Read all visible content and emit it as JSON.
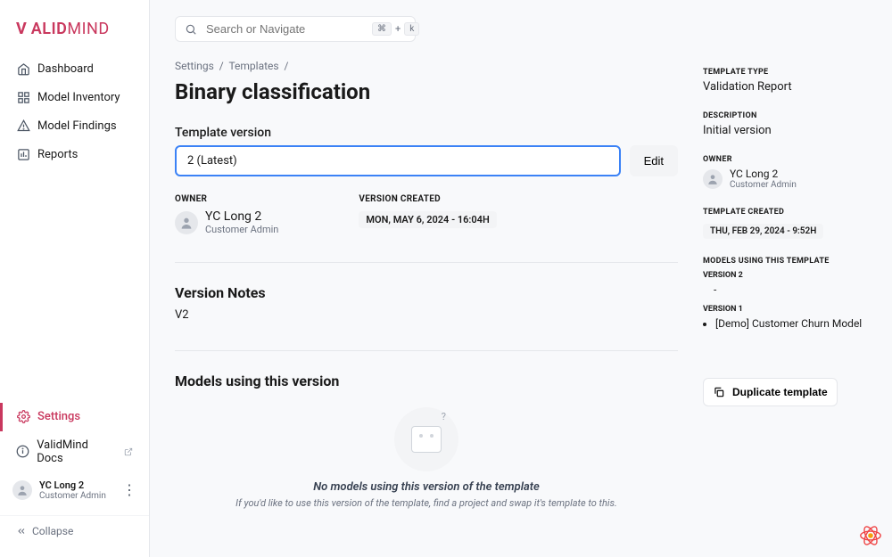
{
  "brand": "VALIDMIND",
  "sidebar": {
    "items": [
      {
        "label": "Dashboard",
        "icon": "home-icon"
      },
      {
        "label": "Model Inventory",
        "icon": "inventory-icon"
      },
      {
        "label": "Model Findings",
        "icon": "findings-icon"
      },
      {
        "label": "Reports",
        "icon": "reports-icon"
      }
    ],
    "settings_label": "Settings",
    "docs_label": "ValidMind Docs",
    "collapse_label": "Collapse"
  },
  "search": {
    "placeholder": "Search or Navigate",
    "kbd1": "⌘",
    "plus": "+",
    "kbd2": "k"
  },
  "breadcrumb": {
    "settings": "Settings",
    "templates": "Templates"
  },
  "page_title": "Binary classification",
  "version_label": "Template version",
  "version_value": "2 (Latest)",
  "edit_label": "Edit",
  "owner_label": "OWNER",
  "owner": {
    "name": "YC Long 2",
    "role": "Customer Admin"
  },
  "version_created_label": "VERSION CREATED",
  "version_created": "MON, MAY 6, 2024 - 16:04H",
  "notes_heading": "Version Notes",
  "notes_body": "V2",
  "models_heading": "Models using this version",
  "empty": {
    "title": "No models using this version of the template",
    "sub": "If you'd like to use this version of the template, find a project and swap it's template to this."
  },
  "right": {
    "template_type_label": "TEMPLATE TYPE",
    "template_type": "Validation Report",
    "description_label": "DESCRIPTION",
    "description": "Initial version",
    "owner_label": "OWNER",
    "owner": {
      "name": "YC Long 2",
      "role": "Customer Admin"
    },
    "template_created_label": "TEMPLATE CREATED",
    "template_created": "THU, FEB 29, 2024 - 9:52H",
    "models_using_label": "MODELS USING THIS TEMPLATE",
    "version2_label": "VERSION 2",
    "version2_item": "-",
    "version1_label": "VERSION 1",
    "version1_item": "[Demo] Customer Churn Model",
    "duplicate_label": "Duplicate template"
  },
  "user": {
    "name": "YC Long 2",
    "role": "Customer Admin"
  }
}
